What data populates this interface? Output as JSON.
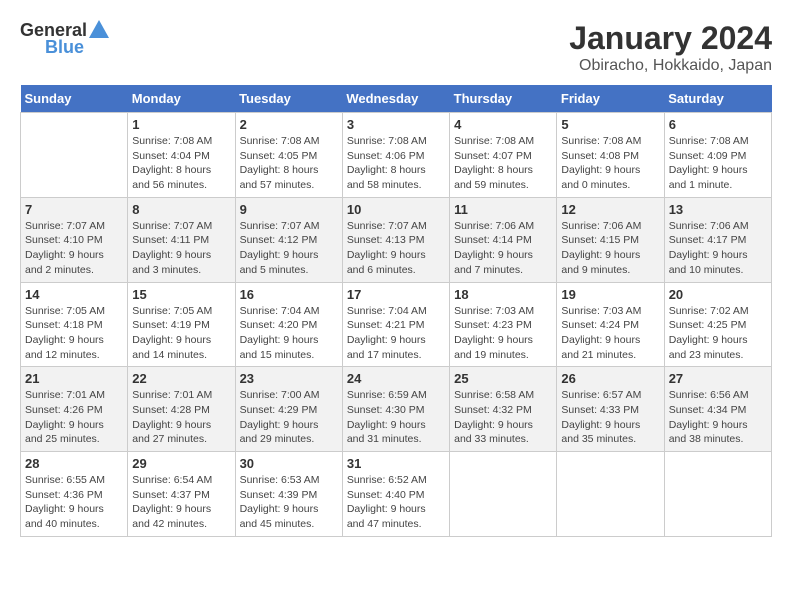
{
  "header": {
    "logo_general": "General",
    "logo_blue": "Blue",
    "month_title": "January 2024",
    "location": "Obiracho, Hokkaido, Japan"
  },
  "days_of_week": [
    "Sunday",
    "Monday",
    "Tuesday",
    "Wednesday",
    "Thursday",
    "Friday",
    "Saturday"
  ],
  "weeks": [
    [
      {
        "day": "",
        "sunrise": "",
        "sunset": "",
        "daylight": ""
      },
      {
        "day": "1",
        "sunrise": "Sunrise: 7:08 AM",
        "sunset": "Sunset: 4:04 PM",
        "daylight": "Daylight: 8 hours and 56 minutes."
      },
      {
        "day": "2",
        "sunrise": "Sunrise: 7:08 AM",
        "sunset": "Sunset: 4:05 PM",
        "daylight": "Daylight: 8 hours and 57 minutes."
      },
      {
        "day": "3",
        "sunrise": "Sunrise: 7:08 AM",
        "sunset": "Sunset: 4:06 PM",
        "daylight": "Daylight: 8 hours and 58 minutes."
      },
      {
        "day": "4",
        "sunrise": "Sunrise: 7:08 AM",
        "sunset": "Sunset: 4:07 PM",
        "daylight": "Daylight: 8 hours and 59 minutes."
      },
      {
        "day": "5",
        "sunrise": "Sunrise: 7:08 AM",
        "sunset": "Sunset: 4:08 PM",
        "daylight": "Daylight: 9 hours and 0 minutes."
      },
      {
        "day": "6",
        "sunrise": "Sunrise: 7:08 AM",
        "sunset": "Sunset: 4:09 PM",
        "daylight": "Daylight: 9 hours and 1 minute."
      }
    ],
    [
      {
        "day": "7",
        "sunrise": "Sunrise: 7:07 AM",
        "sunset": "Sunset: 4:10 PM",
        "daylight": "Daylight: 9 hours and 2 minutes."
      },
      {
        "day": "8",
        "sunrise": "Sunrise: 7:07 AM",
        "sunset": "Sunset: 4:11 PM",
        "daylight": "Daylight: 9 hours and 3 minutes."
      },
      {
        "day": "9",
        "sunrise": "Sunrise: 7:07 AM",
        "sunset": "Sunset: 4:12 PM",
        "daylight": "Daylight: 9 hours and 5 minutes."
      },
      {
        "day": "10",
        "sunrise": "Sunrise: 7:07 AM",
        "sunset": "Sunset: 4:13 PM",
        "daylight": "Daylight: 9 hours and 6 minutes."
      },
      {
        "day": "11",
        "sunrise": "Sunrise: 7:06 AM",
        "sunset": "Sunset: 4:14 PM",
        "daylight": "Daylight: 9 hours and 7 minutes."
      },
      {
        "day": "12",
        "sunrise": "Sunrise: 7:06 AM",
        "sunset": "Sunset: 4:15 PM",
        "daylight": "Daylight: 9 hours and 9 minutes."
      },
      {
        "day": "13",
        "sunrise": "Sunrise: 7:06 AM",
        "sunset": "Sunset: 4:17 PM",
        "daylight": "Daylight: 9 hours and 10 minutes."
      }
    ],
    [
      {
        "day": "14",
        "sunrise": "Sunrise: 7:05 AM",
        "sunset": "Sunset: 4:18 PM",
        "daylight": "Daylight: 9 hours and 12 minutes."
      },
      {
        "day": "15",
        "sunrise": "Sunrise: 7:05 AM",
        "sunset": "Sunset: 4:19 PM",
        "daylight": "Daylight: 9 hours and 14 minutes."
      },
      {
        "day": "16",
        "sunrise": "Sunrise: 7:04 AM",
        "sunset": "Sunset: 4:20 PM",
        "daylight": "Daylight: 9 hours and 15 minutes."
      },
      {
        "day": "17",
        "sunrise": "Sunrise: 7:04 AM",
        "sunset": "Sunset: 4:21 PM",
        "daylight": "Daylight: 9 hours and 17 minutes."
      },
      {
        "day": "18",
        "sunrise": "Sunrise: 7:03 AM",
        "sunset": "Sunset: 4:23 PM",
        "daylight": "Daylight: 9 hours and 19 minutes."
      },
      {
        "day": "19",
        "sunrise": "Sunrise: 7:03 AM",
        "sunset": "Sunset: 4:24 PM",
        "daylight": "Daylight: 9 hours and 21 minutes."
      },
      {
        "day": "20",
        "sunrise": "Sunrise: 7:02 AM",
        "sunset": "Sunset: 4:25 PM",
        "daylight": "Daylight: 9 hours and 23 minutes."
      }
    ],
    [
      {
        "day": "21",
        "sunrise": "Sunrise: 7:01 AM",
        "sunset": "Sunset: 4:26 PM",
        "daylight": "Daylight: 9 hours and 25 minutes."
      },
      {
        "day": "22",
        "sunrise": "Sunrise: 7:01 AM",
        "sunset": "Sunset: 4:28 PM",
        "daylight": "Daylight: 9 hours and 27 minutes."
      },
      {
        "day": "23",
        "sunrise": "Sunrise: 7:00 AM",
        "sunset": "Sunset: 4:29 PM",
        "daylight": "Daylight: 9 hours and 29 minutes."
      },
      {
        "day": "24",
        "sunrise": "Sunrise: 6:59 AM",
        "sunset": "Sunset: 4:30 PM",
        "daylight": "Daylight: 9 hours and 31 minutes."
      },
      {
        "day": "25",
        "sunrise": "Sunrise: 6:58 AM",
        "sunset": "Sunset: 4:32 PM",
        "daylight": "Daylight: 9 hours and 33 minutes."
      },
      {
        "day": "26",
        "sunrise": "Sunrise: 6:57 AM",
        "sunset": "Sunset: 4:33 PM",
        "daylight": "Daylight: 9 hours and 35 minutes."
      },
      {
        "day": "27",
        "sunrise": "Sunrise: 6:56 AM",
        "sunset": "Sunset: 4:34 PM",
        "daylight": "Daylight: 9 hours and 38 minutes."
      }
    ],
    [
      {
        "day": "28",
        "sunrise": "Sunrise: 6:55 AM",
        "sunset": "Sunset: 4:36 PM",
        "daylight": "Daylight: 9 hours and 40 minutes."
      },
      {
        "day": "29",
        "sunrise": "Sunrise: 6:54 AM",
        "sunset": "Sunset: 4:37 PM",
        "daylight": "Daylight: 9 hours and 42 minutes."
      },
      {
        "day": "30",
        "sunrise": "Sunrise: 6:53 AM",
        "sunset": "Sunset: 4:39 PM",
        "daylight": "Daylight: 9 hours and 45 minutes."
      },
      {
        "day": "31",
        "sunrise": "Sunrise: 6:52 AM",
        "sunset": "Sunset: 4:40 PM",
        "daylight": "Daylight: 9 hours and 47 minutes."
      },
      {
        "day": "",
        "sunrise": "",
        "sunset": "",
        "daylight": ""
      },
      {
        "day": "",
        "sunrise": "",
        "sunset": "",
        "daylight": ""
      },
      {
        "day": "",
        "sunrise": "",
        "sunset": "",
        "daylight": ""
      }
    ]
  ]
}
